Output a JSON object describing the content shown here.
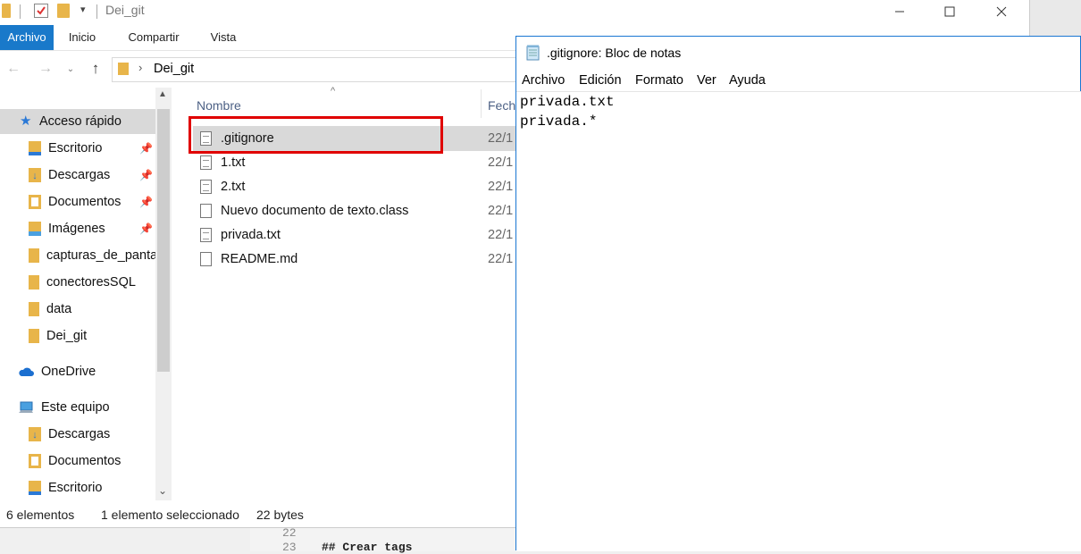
{
  "explorer": {
    "window_title": "Dei_git",
    "ribbon_tabs": [
      "Archivo",
      "Inicio",
      "Compartir",
      "Vista"
    ],
    "address_path": "Dei_git",
    "sidebar": {
      "items": [
        {
          "label": "Acceso rápido",
          "icon": "star-icon"
        },
        {
          "label": "Escritorio",
          "icon": "desktop-folder-icon",
          "pinned": true
        },
        {
          "label": "Descargas",
          "icon": "downloads-folder-icon",
          "pinned": true
        },
        {
          "label": "Documentos",
          "icon": "documents-folder-icon",
          "pinned": true
        },
        {
          "label": "Imágenes",
          "icon": "pictures-folder-icon",
          "pinned": true
        },
        {
          "label": "capturas_de_pantalla",
          "icon": "folder-icon"
        },
        {
          "label": "conectoresSQL",
          "icon": "folder-icon"
        },
        {
          "label": "data",
          "icon": "folder-icon"
        },
        {
          "label": "Dei_git",
          "icon": "folder-icon"
        },
        {
          "label": "OneDrive",
          "icon": "cloud-icon"
        },
        {
          "label": "Este equipo",
          "icon": "computer-icon"
        },
        {
          "label": "Descargas",
          "icon": "downloads-folder-icon"
        },
        {
          "label": "Documentos",
          "icon": "documents-folder-icon"
        },
        {
          "label": "Escritorio",
          "icon": "desktop-folder-icon"
        }
      ]
    },
    "columns": {
      "name": "Nombre",
      "date": "Fech"
    },
    "files": [
      {
        "name": ".gitignore",
        "date": "22/1",
        "selected": true
      },
      {
        "name": "1.txt",
        "date": "22/1"
      },
      {
        "name": "2.txt",
        "date": "22/1"
      },
      {
        "name": "Nuevo documento de texto.class",
        "date": "22/1"
      },
      {
        "name": "privada.txt",
        "date": "22/1"
      },
      {
        "name": "README.md",
        "date": "22/1"
      }
    ],
    "status": {
      "count": "6 elementos",
      "selected": "1 elemento seleccionado",
      "size": "22 bytes"
    }
  },
  "notepad": {
    "title": ".gitignore: Bloc de notas",
    "menu": [
      "Archivo",
      "Edición",
      "Formato",
      "Ver",
      "Ayuda"
    ],
    "lines": [
      "privada.txt",
      "privada.*"
    ]
  },
  "background_editor": {
    "line1": "22",
    "line2": "23",
    "code": "## Crear tags"
  },
  "colors": {
    "accent": "#1979ca",
    "highlight_box": "#e00000",
    "selection": "#d9d9d9"
  }
}
